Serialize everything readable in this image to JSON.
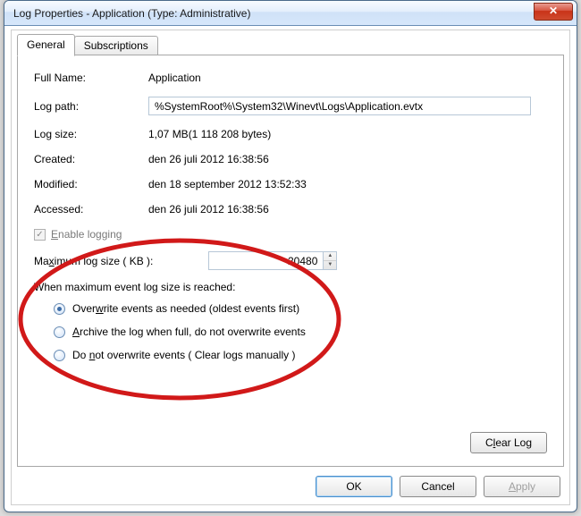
{
  "window": {
    "title": "Log Properties - Application (Type: Administrative)",
    "close_glyph": "✕"
  },
  "tabs": {
    "general": "General",
    "subscriptions": "Subscriptions"
  },
  "fields": {
    "full_name": {
      "label": "Full Name:",
      "value": "Application"
    },
    "log_path": {
      "label": "Log path:",
      "value": "%SystemRoot%\\System32\\Winevt\\Logs\\Application.evtx"
    },
    "log_size": {
      "label": "Log size:",
      "value": "1,07 MB(1 118 208 bytes)"
    },
    "created": {
      "label": "Created:",
      "value": "den 26 juli 2012 16:38:56"
    },
    "modified": {
      "label": "Modified:",
      "value": "den 18 september 2012 13:52:33"
    },
    "accessed": {
      "label": "Accessed:",
      "value": "den 26 juli 2012 16:38:56"
    }
  },
  "enable_logging": {
    "label_pre": "E",
    "label_post": "nable logging"
  },
  "max_size": {
    "label_pre": "Ma",
    "label_x": "x",
    "label_post": "imum log size ( KB ):",
    "value": "20480"
  },
  "when_full": {
    "heading": "When maximum event log size is reached:",
    "options": [
      {
        "pre": "Over",
        "u": "w",
        "post": "rite events as needed (oldest events first)",
        "checked": true
      },
      {
        "pre": "",
        "u": "A",
        "post": "rchive the log when full, do not overwrite events",
        "checked": false
      },
      {
        "pre": "Do ",
        "u": "n",
        "post": "ot overwrite events ( Clear logs manually )",
        "checked": false
      }
    ]
  },
  "buttons": {
    "clear_pre": "C",
    "clear_u": "l",
    "clear_post": "ear Log",
    "ok": "OK",
    "cancel": "Cancel",
    "apply_u": "A",
    "apply_post": "pply"
  }
}
